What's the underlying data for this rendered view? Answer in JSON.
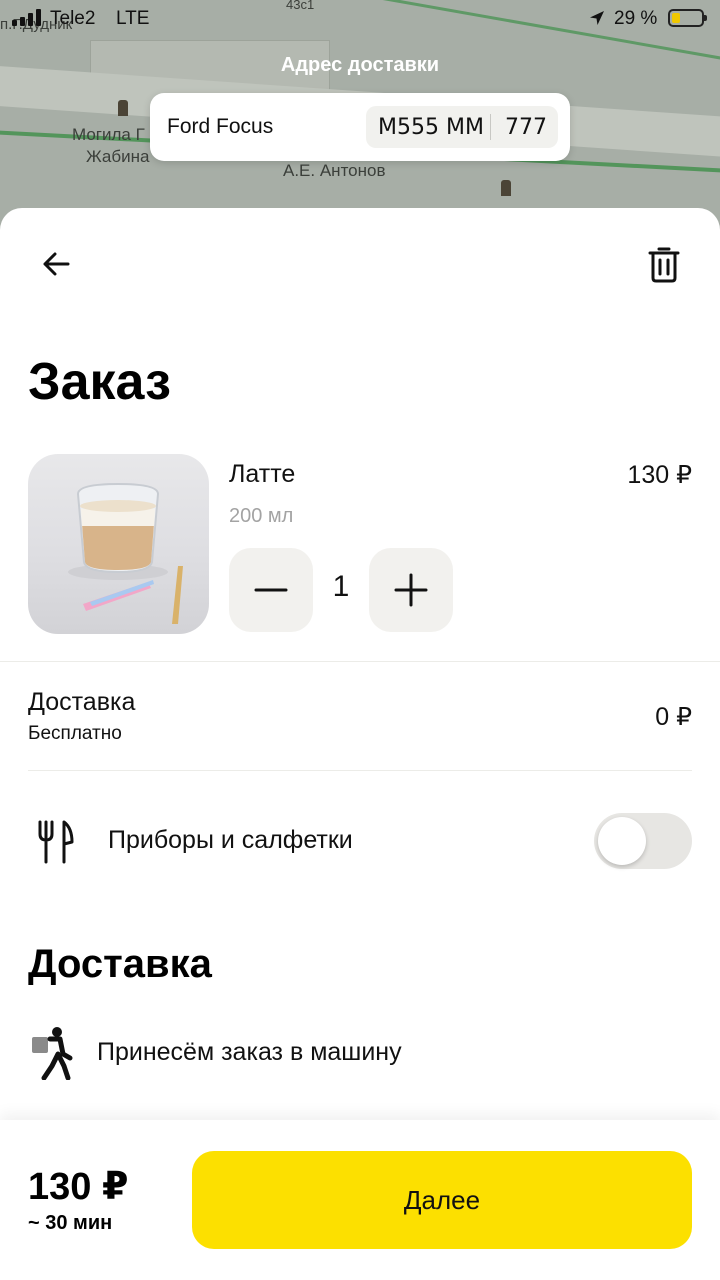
{
  "status_bar": {
    "carrier": "Tele2",
    "network": "LTE",
    "battery_percent": "29 %",
    "battery_level": 0.29
  },
  "map": {
    "labels": [
      "Могила Г",
      "Жабина",
      "А.Е. Антонов",
      "п.Г.Дудник",
      "43с1"
    ]
  },
  "address": {
    "title": "Адрес доставки",
    "car_name": "Ford Focus",
    "plate_number": "М555 ММ",
    "plate_region": "777"
  },
  "order": {
    "title": "Заказ",
    "item": {
      "name": "Латте",
      "volume": "200 мл",
      "price": "130 ₽",
      "quantity": "1"
    },
    "delivery_cost": {
      "label": "Доставка",
      "sublabel": "Бесплатно",
      "price": "0 ₽"
    },
    "cutlery": {
      "label": "Приборы и салфетки",
      "enabled": false
    }
  },
  "delivery": {
    "title": "Доставка",
    "option": "Принесём заказ в машину"
  },
  "footer": {
    "total": "130 ₽",
    "eta": "~ 30 мин",
    "next_label": "Далее"
  },
  "colors": {
    "accent": "#fce000",
    "stepper_bg": "#f2f1ee",
    "toggle_off": "#e7e6e3"
  },
  "icons": {
    "back": "arrow-left-icon",
    "delete": "trash-icon",
    "minus": "minus-icon",
    "plus": "plus-icon",
    "cutlery": "fork-knife-icon",
    "courier": "courier-icon",
    "location": "location-arrow-icon"
  }
}
